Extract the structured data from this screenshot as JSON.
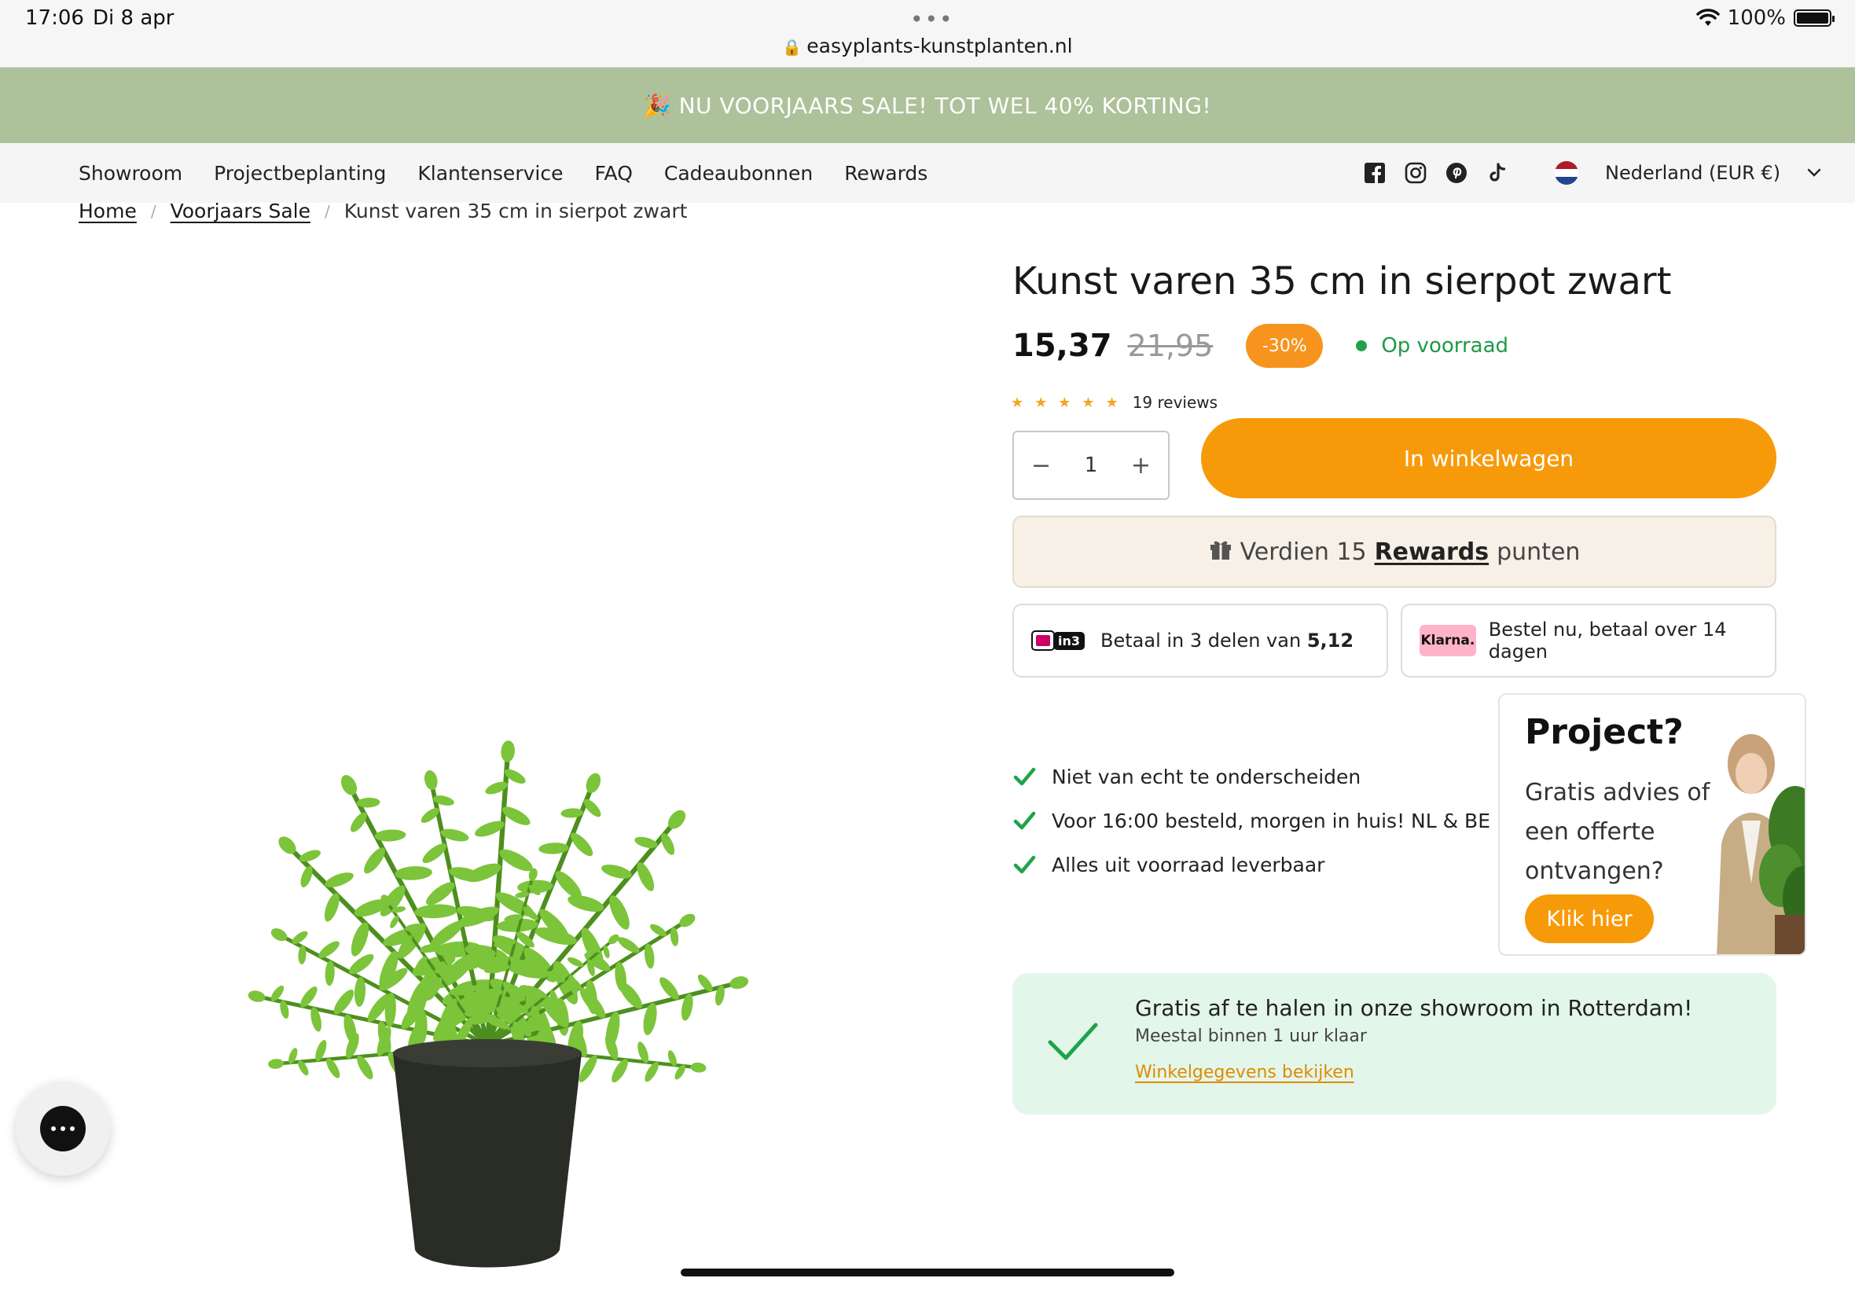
{
  "status_bar": {
    "time": "17:06",
    "date": "Di 8 apr",
    "battery": "100%",
    "url": "easyplants-kunstplanten.nl"
  },
  "promo": {
    "text": "🎉 NU VOORJAARS SALE! TOT WEL 40% KORTING!"
  },
  "nav": {
    "links": [
      "Showroom",
      "Projectbeplanting",
      "Klantenservice",
      "FAQ",
      "Cadeaubonnen",
      "Rewards"
    ],
    "country": "Nederland (EUR €)"
  },
  "breadcrumb": [
    "Home",
    "Voorjaars Sale",
    "Kunst varen 35 cm in sierpot zwart"
  ],
  "product": {
    "title": "Kunst varen 35 cm in sierpot zwart",
    "price_now": "15,37",
    "price_old": "21,95",
    "discount": "-30%",
    "stock": "Op voorraad",
    "stars": "★★★★★",
    "rating": 5,
    "reviews": "19 reviews",
    "quantity": "1",
    "qty_minus": "−",
    "qty_plus": "+",
    "cart_button": "In winkelwagen"
  },
  "rewards": {
    "prefix": "Verdien 15",
    "link": "Rewards",
    "suffix": "punten"
  },
  "payment": {
    "in3_text": "Betaal in 3 delen van",
    "in3_amount": "5,12",
    "in3_logo": "in3",
    "klarna_logo": "Klarna.",
    "klarna_text": "Bestel nu, betaal over 14 dagen"
  },
  "usps": [
    "Niet van echt te onderscheiden",
    "Voor 16:00 besteld, morgen in huis! NL & BE",
    "Alles uit voorraad leverbaar"
  ],
  "project": {
    "title": "Project?",
    "subtitle": "Gratis advies of een offerte ontvangen?",
    "button": "Klik hier"
  },
  "pickup": {
    "title": "Gratis af te halen in onze showroom in Rotterdam!",
    "subtitle": "Meestal binnen 1 uur klaar",
    "link": "Winkelgegevens bekijken"
  },
  "colors": {
    "promo_bg": "#adc19a",
    "accent_orange": "#f79a0a",
    "stock_green": "#1f9a46",
    "pickup_bg": "#e3f6ea",
    "rewards_bg": "#f6f0e6"
  },
  "icons": [
    "lock-icon",
    "wifi-icon",
    "battery-icon",
    "facebook-icon",
    "instagram-icon",
    "pinterest-icon",
    "tiktok-icon",
    "netherlands-flag-icon",
    "chevron-down-icon",
    "gift-icon",
    "check-icon",
    "chat-icon"
  ]
}
